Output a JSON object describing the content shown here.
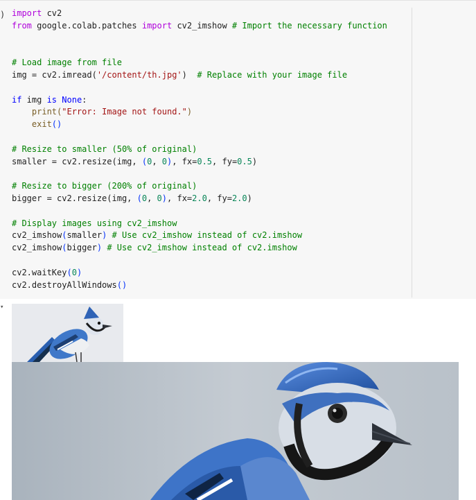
{
  "code_cell": {
    "lines": [
      [
        {
          "t": "import",
          "c": "kw2"
        },
        {
          "t": " cv2",
          "c": ""
        }
      ],
      [
        {
          "t": "from",
          "c": "kw2"
        },
        {
          "t": " google.colab.patches ",
          "c": ""
        },
        {
          "t": "import",
          "c": "kw2"
        },
        {
          "t": " cv2_imshow ",
          "c": ""
        },
        {
          "t": "# Import the necessary function",
          "c": "cm"
        }
      ],
      [],
      [],
      [
        {
          "t": "# Load image from file",
          "c": "cm"
        }
      ],
      [
        {
          "t": "img = cv2.imread(",
          "c": ""
        },
        {
          "t": "'/content/th.jpg'",
          "c": "st"
        },
        {
          "t": ")  ",
          "c": ""
        },
        {
          "t": "# Replace with your image file",
          "c": "cm"
        }
      ],
      [],
      [
        {
          "t": "if",
          "c": "kw"
        },
        {
          "t": " img ",
          "c": ""
        },
        {
          "t": "is",
          "c": "kw"
        },
        {
          "t": " ",
          "c": ""
        },
        {
          "t": "None",
          "c": "kw"
        },
        {
          "t": ":",
          "c": ""
        }
      ],
      [
        {
          "t": "    print(",
          "c": "fn"
        },
        {
          "t": "\"Error: Image not found.\"",
          "c": "st"
        },
        {
          "t": ")",
          "c": "fn"
        }
      ],
      [
        {
          "t": "    exit",
          "c": "fn"
        },
        {
          "t": "()",
          "c": "pn"
        }
      ],
      [],
      [
        {
          "t": "# Resize to smaller (50% of original)",
          "c": "cm"
        }
      ],
      [
        {
          "t": "smaller = cv2.resize(img, ",
          "c": ""
        },
        {
          "t": "(",
          "c": "pn"
        },
        {
          "t": "0",
          "c": "num"
        },
        {
          "t": ", ",
          "c": ""
        },
        {
          "t": "0",
          "c": "num"
        },
        {
          "t": ")",
          "c": "pn"
        },
        {
          "t": ", fx=",
          "c": ""
        },
        {
          "t": "0.5",
          "c": "num"
        },
        {
          "t": ", fy=",
          "c": ""
        },
        {
          "t": "0.5",
          "c": "num"
        },
        {
          "t": ")",
          "c": ""
        }
      ],
      [],
      [
        {
          "t": "# Resize to bigger (200% of original)",
          "c": "cm"
        }
      ],
      [
        {
          "t": "bigger = cv2.resize(img, ",
          "c": ""
        },
        {
          "t": "(",
          "c": "pn"
        },
        {
          "t": "0",
          "c": "num"
        },
        {
          "t": ", ",
          "c": ""
        },
        {
          "t": "0",
          "c": "num"
        },
        {
          "t": ")",
          "c": "pn"
        },
        {
          "t": ", fx=",
          "c": ""
        },
        {
          "t": "2.0",
          "c": "num"
        },
        {
          "t": ", fy=",
          "c": ""
        },
        {
          "t": "2.0",
          "c": "num"
        },
        {
          "t": ")",
          "c": ""
        }
      ],
      [],
      [
        {
          "t": "# Display images using cv2_imshow",
          "c": "cm"
        }
      ],
      [
        {
          "t": "cv2_imshow",
          "c": ""
        },
        {
          "t": "(",
          "c": "pn"
        },
        {
          "t": "smaller",
          "c": ""
        },
        {
          "t": ")",
          "c": "pn"
        },
        {
          "t": " ",
          "c": ""
        },
        {
          "t": "# Use cv2_imshow instead of cv2.imshow",
          "c": "cm"
        }
      ],
      [
        {
          "t": "cv2_imshow",
          "c": ""
        },
        {
          "t": "(",
          "c": "pn"
        },
        {
          "t": "bigger",
          "c": ""
        },
        {
          "t": ")",
          "c": "pn"
        },
        {
          "t": " ",
          "c": ""
        },
        {
          "t": "# Use cv2_imshow instead of cv2.imshow",
          "c": "cm"
        }
      ],
      [],
      [
        {
          "t": "cv2.waitKey",
          "c": ""
        },
        {
          "t": "(",
          "c": "pn"
        },
        {
          "t": "0",
          "c": "num"
        },
        {
          "t": ")",
          "c": "pn"
        }
      ],
      [
        {
          "t": "cv2.destroyAllWindows",
          "c": ""
        },
        {
          "t": "()",
          "c": "pn"
        }
      ]
    ]
  },
  "output": {
    "toggle_icon": "chevron-down-icon",
    "images": [
      {
        "name": "blue-jay-small",
        "subject": "blue jay"
      },
      {
        "name": "blue-jay-large",
        "subject": "blue jay"
      }
    ]
  },
  "colors": {
    "cell_bg": "#f7f7f7",
    "keyword": "#af00db",
    "builtin": "#0000ff",
    "comment": "#008000",
    "string": "#a31515",
    "number": "#098658"
  }
}
